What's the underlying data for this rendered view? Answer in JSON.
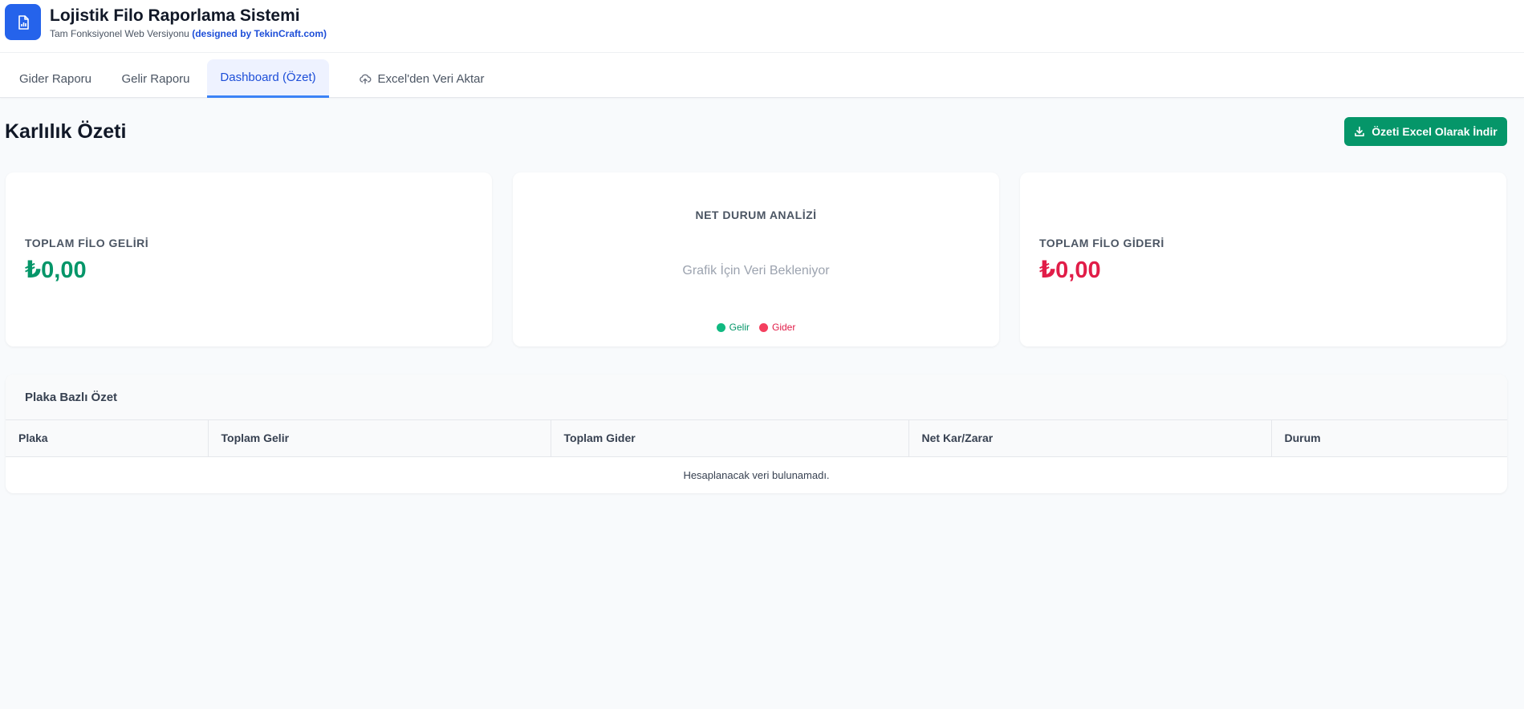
{
  "app": {
    "title": "Lojistik Filo Raporlama Sistemi",
    "subtitle": "Tam Fonksiyonel Web Versiyonu",
    "credit": "(designed by TekinCraft.com)",
    "logo_icon": "report-document-icon",
    "brand_color": "#2563eb"
  },
  "tabs": [
    {
      "label": "Gider Raporu",
      "active": false
    },
    {
      "label": "Gelir Raporu",
      "active": false
    },
    {
      "label": "Dashboard (Özet)",
      "active": true
    },
    {
      "label": "Excel'den Veri Aktar",
      "active": false,
      "icon": "cloud-upload-icon"
    }
  ],
  "dashboard": {
    "title": "Karlılık Özeti",
    "download_label": "Özeti Excel Olarak İndir",
    "download_icon": "download-icon",
    "download_color": "#059669"
  },
  "cards": {
    "income": {
      "label": "TOPLAM FİLO GELİRİ",
      "value": "₺0,00",
      "color": "#059669"
    },
    "chart": {
      "title": "NET DURUM ANALİZİ",
      "placeholder": "Grafik İçin Veri Bekleniyor",
      "legend": [
        {
          "label": "Gelir",
          "color": "#10b981"
        },
        {
          "label": "Gider",
          "color": "#f43f5e"
        }
      ]
    },
    "expense": {
      "label": "TOPLAM FİLO GİDERİ",
      "value": "₺0,00",
      "color": "#e11d48"
    }
  },
  "plate_summary": {
    "title": "Plaka Bazlı Özet",
    "columns": [
      "Plaka",
      "Toplam Gelir",
      "Toplam Gider",
      "Net Kar/Zarar",
      "Durum"
    ],
    "empty_message": "Hesaplanacak veri bulunamadı."
  }
}
